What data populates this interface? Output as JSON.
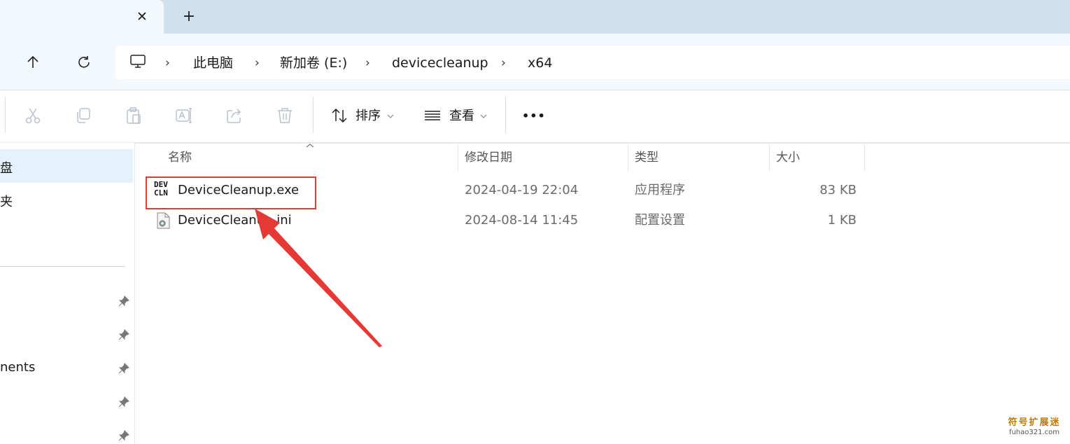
{
  "window": {
    "tab_close_glyph": "✕",
    "new_tab_glyph": "+"
  },
  "address": {
    "crumbs": [
      "此电脑",
      "新加卷 (E:)",
      "devicecleanup",
      "x64"
    ],
    "separator": "›"
  },
  "toolbar": {
    "sort_label": "排序",
    "view_label": "查看",
    "more_glyph": "•••",
    "icons": [
      "cut-icon",
      "copy-icon",
      "paste-icon",
      "rename-icon",
      "share-icon",
      "delete-icon"
    ]
  },
  "sidebar": {
    "items": [
      {
        "label": "盘",
        "selected": true
      },
      {
        "label": "夹",
        "selected": false
      },
      {
        "label": "nents",
        "selected": false
      }
    ]
  },
  "file_list": {
    "columns": {
      "name": "名称",
      "modified": "修改日期",
      "type": "类型",
      "size": "大小"
    },
    "rows": [
      {
        "name": "DeviceCleanup.exe",
        "modified": "2024-04-19 22:04",
        "type": "应用程序",
        "size": "83 KB",
        "icon": "exe-icon"
      },
      {
        "name": "DeviceCleanup.ini",
        "modified": "2024-08-14 11:45",
        "type": "配置设置",
        "size": "1 KB",
        "icon": "ini-settings-icon"
      }
    ]
  },
  "exe_icon_text": {
    "line1": "DEV",
    "line2": "CLN"
  },
  "annotation": {
    "highlight_color": "#e53935"
  },
  "watermark": {
    "line1": "符号扩展迷",
    "line2": "fuhao321.com"
  },
  "colors": {
    "tabstrip": "#cfe0ee",
    "navbar": "#f3f8fc",
    "selection": "#e5f1fb"
  }
}
